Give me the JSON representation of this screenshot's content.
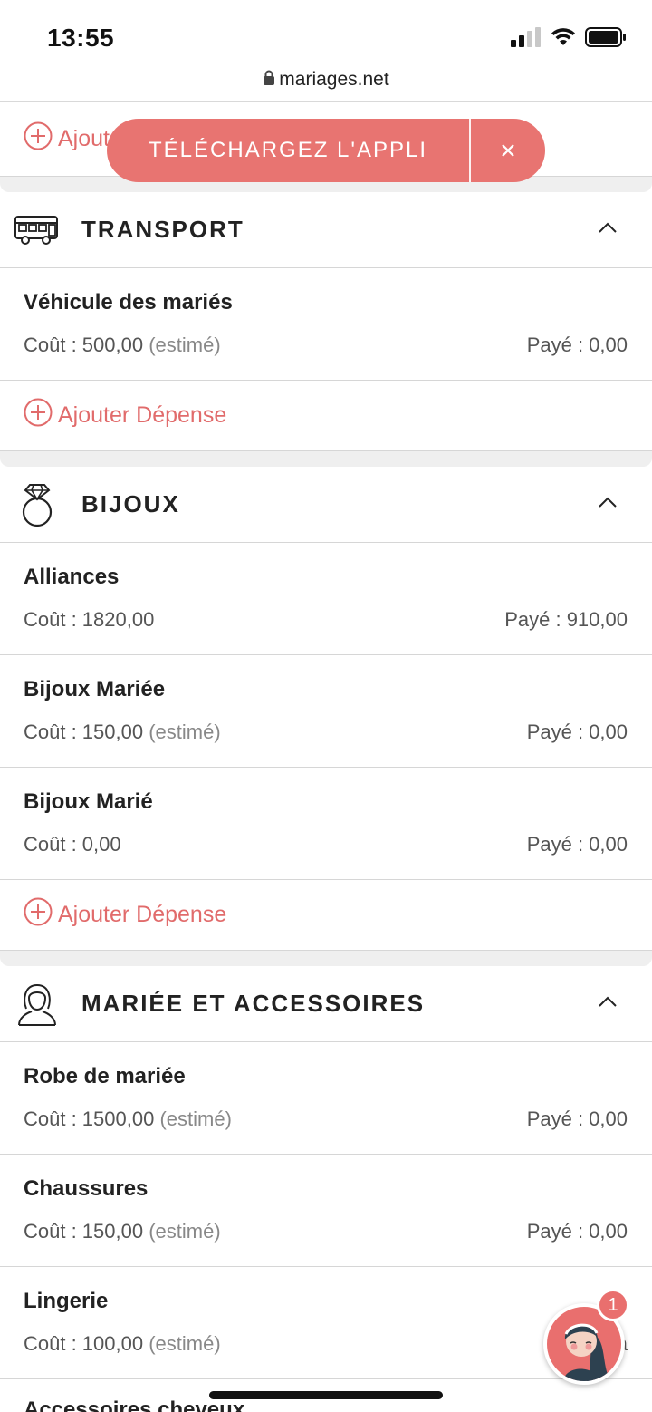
{
  "status": {
    "time": "13:55"
  },
  "browser": {
    "url": "mariages.net"
  },
  "banner": {
    "label": "TÉLÉCHARGEZ L'APPLI"
  },
  "top_add_label": "Ajouter Dépense",
  "sections": [
    {
      "title": "TRANSPORT",
      "icon": "bus-icon",
      "items": [
        {
          "name": "Véhicule des mariés",
          "cost": "Coût : 500,00",
          "estimated": "(estimé)",
          "paid": "Payé : 0,00"
        }
      ],
      "add_label": "Ajouter Dépense"
    },
    {
      "title": "BIJOUX",
      "icon": "ring-icon",
      "items": [
        {
          "name": "Alliances",
          "cost": "Coût : 1820,00",
          "estimated": "",
          "paid": "Payé : 910,00"
        },
        {
          "name": "Bijoux Mariée",
          "cost": "Coût : 150,00",
          "estimated": "(estimé)",
          "paid": "Payé : 0,00"
        },
        {
          "name": "Bijoux Marié",
          "cost": "Coût : 0,00",
          "estimated": "",
          "paid": "Payé : 0,00"
        }
      ],
      "add_label": "Ajouter Dépense"
    },
    {
      "title": "MARIÉE ET ACCESSOIRES",
      "icon": "bride-icon",
      "items": [
        {
          "name": "Robe de mariée",
          "cost": "Coût : 1500,00",
          "estimated": "(estimé)",
          "paid": "Payé : 0,00"
        },
        {
          "name": "Chaussures",
          "cost": "Coût : 150,00",
          "estimated": "(estimé)",
          "paid": "Payé : 0,00"
        },
        {
          "name": "Lingerie",
          "cost": "Coût : 100,00",
          "estimated": "(estimé)",
          "paid": "Pa"
        }
      ]
    }
  ],
  "cut_off_item": "Accessoires cheveux",
  "chat": {
    "badge_count": "1"
  },
  "colors": {
    "accent": "#e87471",
    "divider": "#d6d6d6",
    "gap": "#efefef"
  }
}
